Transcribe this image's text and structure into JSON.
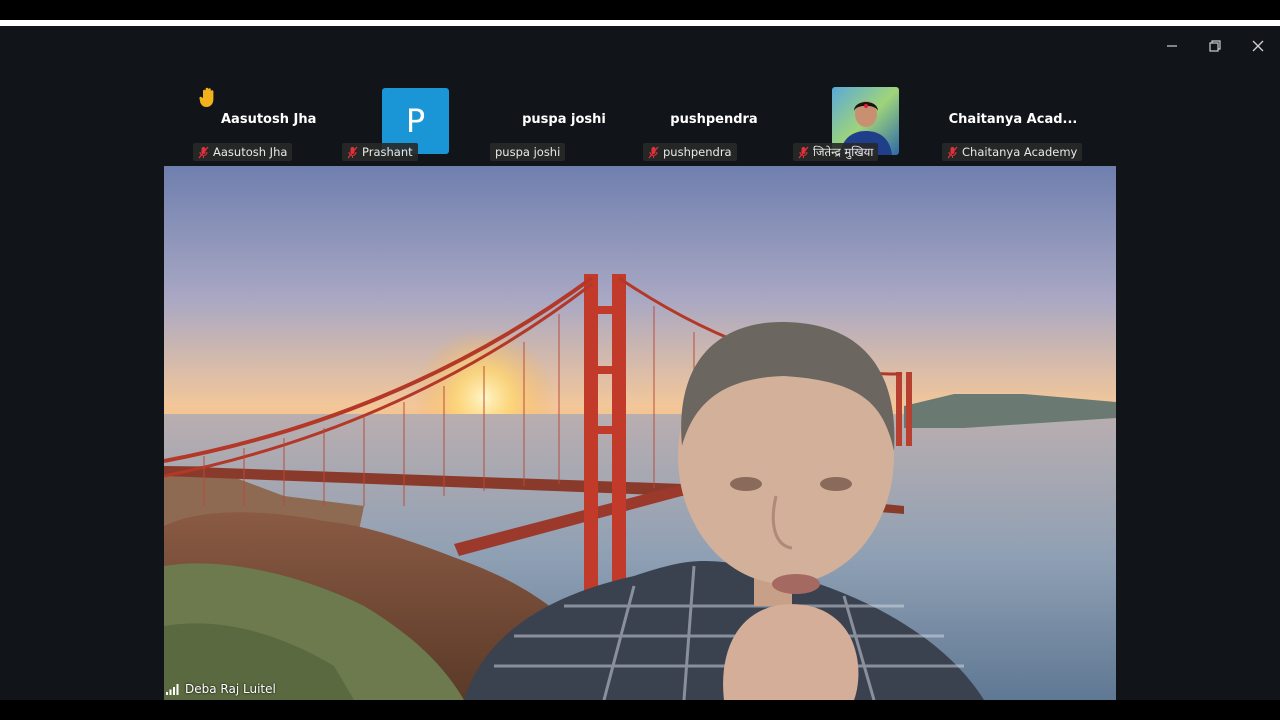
{
  "window": {
    "controls": {
      "minimize": "minimize-icon",
      "restore": "restore-icon",
      "close": "close-icon"
    }
  },
  "participants": [
    {
      "display_name": "Aasutosh Jha",
      "tag": "Aasutosh Jha",
      "muted": true,
      "hand_raised": true,
      "avatar": "none"
    },
    {
      "display_name": "",
      "tag": "Prashant",
      "muted": true,
      "hand_raised": false,
      "avatar": "letter",
      "avatar_letter": "P",
      "avatar_color": "#1a95d6"
    },
    {
      "display_name": "puspa joshi",
      "tag": "puspa joshi",
      "muted": false,
      "hand_raised": false,
      "avatar": "none"
    },
    {
      "display_name": "pushpendra",
      "tag": "pushpendra",
      "muted": true,
      "hand_raised": false,
      "avatar": "none"
    },
    {
      "display_name": "",
      "tag": "जितेन्द्र मुखिया",
      "muted": true,
      "hand_raised": false,
      "avatar": "photo"
    },
    {
      "display_name": "Chaitanya  Acad...",
      "tag": "Chaitanya Academy",
      "muted": true,
      "hand_raised": false,
      "avatar": "none"
    }
  ],
  "main_video": {
    "speaker_name": "Deba Raj Luitel",
    "background": "golden-gate-bridge-sunset",
    "signal_icon": "signal-strength-icon"
  },
  "colors": {
    "window_bg": "#111418",
    "mute_red": "#e0303a",
    "avatar_blue": "#1a95d6"
  }
}
